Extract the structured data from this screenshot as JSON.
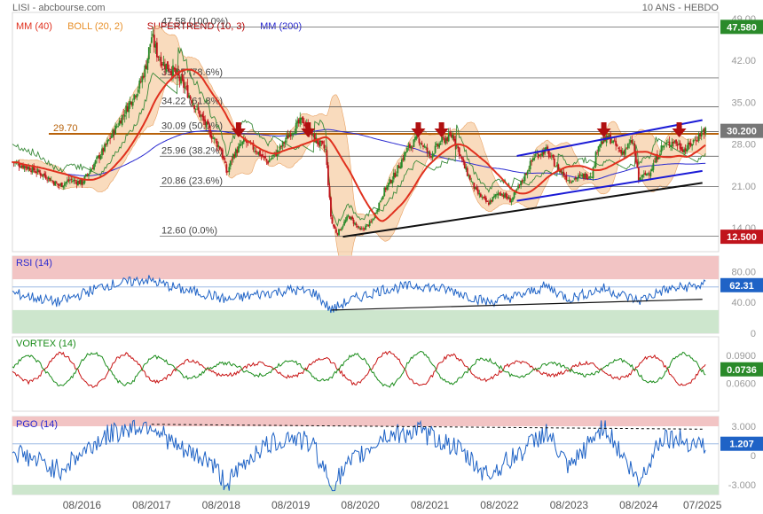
{
  "header": {
    "left": "LISI - abcbourse.com",
    "right": "10 ANS - HEBDO"
  },
  "legend": [
    {
      "label": "MM (40)",
      "color": "#e0301e"
    },
    {
      "label": "BOLL (20, 2)",
      "color": "#e8902a"
    },
    {
      "label": "SUPERTREND (10, 3)",
      "color": "#b80000"
    },
    {
      "label": "MM (200)",
      "color": "#2a2ad0"
    }
  ],
  "colors": {
    "candle_up": "#2a8a2a",
    "candle_down": "#c0141c",
    "boll_fill": "#f6c89a",
    "rsi": "#1f63c6",
    "vortex_plus": "#1a8c1a",
    "vortex_minus": "#c81414",
    "pgo": "#1f63c6",
    "zone_high": "#f2c4c4",
    "zone_low": "#cde6cd",
    "channel": "#1a1ad6",
    "trend_support": "#111111",
    "horizontal_level": "#b8620a",
    "signal_arrow": "#b01010"
  },
  "chart_data": [
    {
      "type": "candlestick",
      "title": "LISI",
      "period": "weekly, 10 years",
      "x_ticks": [
        "08/2016",
        "08/2017",
        "08/2018",
        "08/2019",
        "08/2020",
        "08/2021",
        "08/2022",
        "08/2023",
        "08/2024",
        "07/2025"
      ],
      "y_ticks": [
        14.0,
        21.0,
        28.0,
        35.0,
        42.0,
        49.0
      ],
      "y_range": [
        10,
        50
      ],
      "last_price": "30.200",
      "high_marker": "47.580",
      "low_marker": "12.500",
      "horizontal_level": {
        "label": "29.70",
        "value": 29.7
      },
      "fibonacci": [
        {
          "label": "47.58 (100.0%)",
          "value": 47.58
        },
        {
          "label": "39.05 (78.6%)",
          "value": 39.05
        },
        {
          "label": "34.22 (61.8%)",
          "value": 34.22
        },
        {
          "label": "30.09 (50.0%)",
          "value": 30.09
        },
        {
          "label": "25.96 (38.2%)",
          "value": 25.96
        },
        {
          "label": "20.86 (23.6%)",
          "value": 20.86
        },
        {
          "label": "12.60 (0.0%)",
          "value": 12.6
        }
      ],
      "close_path": [
        [
          "2015-08",
          25.0
        ],
        [
          "2015-11",
          24.0
        ],
        [
          "2016-02",
          22.5
        ],
        [
          "2016-04",
          21.0
        ],
        [
          "2016-06",
          22.0
        ],
        [
          "2016-08",
          21.5
        ],
        [
          "2016-10",
          24.5
        ],
        [
          "2016-12",
          27.5
        ],
        [
          "2017-02",
          31.0
        ],
        [
          "2017-04",
          34.5
        ],
        [
          "2017-06",
          38.0
        ],
        [
          "2017-07",
          41.0
        ],
        [
          "2017-08",
          46.0
        ],
        [
          "2017-09",
          43.0
        ],
        [
          "2017-10",
          41.5
        ],
        [
          "2017-12",
          40.0
        ],
        [
          "2018-02",
          37.0
        ],
        [
          "2018-04",
          33.5
        ],
        [
          "2018-06",
          30.0
        ],
        [
          "2018-08",
          27.0
        ],
        [
          "2018-09",
          23.0
        ],
        [
          "2018-10",
          26.0
        ],
        [
          "2018-12",
          28.5
        ],
        [
          "2019-02",
          27.0
        ],
        [
          "2019-04",
          25.0
        ],
        [
          "2019-06",
          27.0
        ],
        [
          "2019-08",
          30.0
        ],
        [
          "2019-10",
          32.0
        ],
        [
          "2019-12",
          29.0
        ],
        [
          "2020-02",
          27.0
        ],
        [
          "2020-03",
          15.0
        ],
        [
          "2020-04",
          13.0
        ],
        [
          "2020-06",
          16.0
        ],
        [
          "2020-08",
          13.5
        ],
        [
          "2020-10",
          15.0
        ],
        [
          "2020-12",
          20.0
        ],
        [
          "2021-02",
          23.0
        ],
        [
          "2021-04",
          27.0
        ],
        [
          "2021-06",
          29.0
        ],
        [
          "2021-08",
          26.0
        ],
        [
          "2021-10",
          28.5
        ],
        [
          "2021-12",
          29.5
        ],
        [
          "2022-02",
          24.0
        ],
        [
          "2022-04",
          20.0
        ],
        [
          "2022-06",
          18.0
        ],
        [
          "2022-08",
          20.0
        ],
        [
          "2022-10",
          18.5
        ],
        [
          "2022-12",
          22.0
        ],
        [
          "2023-02",
          26.0
        ],
        [
          "2023-04",
          27.0
        ],
        [
          "2023-06",
          24.0
        ],
        [
          "2023-08",
          22.0
        ],
        [
          "2023-10",
          22.5
        ],
        [
          "2023-12",
          23.0
        ],
        [
          "2024-01",
          28.0
        ],
        [
          "2024-03",
          29.0
        ],
        [
          "2024-05",
          26.5
        ],
        [
          "2024-07",
          28.5
        ],
        [
          "2024-08",
          22.0
        ],
        [
          "2024-10",
          23.5
        ],
        [
          "2024-12",
          27.5
        ],
        [
          "2025-02",
          28.5
        ],
        [
          "2025-04",
          27.0
        ],
        [
          "2025-06",
          29.0
        ],
        [
          "2025-07",
          30.2
        ]
      ],
      "signal_arrows": [
        "2018-11",
        "2019-11",
        "2021-06",
        "2021-10",
        "2024-02",
        "2025-03"
      ],
      "support_trend": [
        [
          "2020-05",
          12.5
        ],
        [
          "2025-07",
          21.5
        ]
      ],
      "channel_upper": [
        [
          "2022-11",
          26.0
        ],
        [
          "2025-07",
          32.0
        ]
      ],
      "channel_lower": [
        [
          "2022-11",
          18.5
        ],
        [
          "2025-07",
          23.5
        ]
      ]
    },
    {
      "type": "line",
      "title": "RSI (14)",
      "y_ticks": [
        0,
        40.0,
        80.0
      ],
      "y_range": [
        0,
        100
      ],
      "zones": [
        {
          "from": 70,
          "to": 100,
          "kind": "overbought"
        },
        {
          "from": 0,
          "to": 30,
          "kind": "oversold"
        }
      ],
      "reference_line": 60,
      "last_value": "62.31",
      "path": [
        [
          "2015-08",
          52
        ],
        [
          "2016-04",
          40
        ],
        [
          "2016-12",
          62
        ],
        [
          "2017-04",
          66
        ],
        [
          "2017-07",
          70
        ],
        [
          "2018-01",
          57
        ],
        [
          "2018-06",
          50
        ],
        [
          "2018-09",
          43
        ],
        [
          "2019-02",
          50
        ],
        [
          "2019-08",
          56
        ],
        [
          "2019-12",
          53
        ],
        [
          "2020-03",
          30
        ],
        [
          "2020-06",
          42
        ],
        [
          "2020-12",
          57
        ],
        [
          "2021-06",
          62
        ],
        [
          "2021-12",
          55
        ],
        [
          "2022-06",
          40
        ],
        [
          "2022-12",
          50
        ],
        [
          "2023-04",
          61
        ],
        [
          "2023-08",
          45
        ],
        [
          "2024-02",
          58
        ],
        [
          "2024-08",
          42
        ],
        [
          "2024-12",
          55
        ],
        [
          "2025-04",
          60
        ],
        [
          "2025-07",
          62.31
        ]
      ],
      "trend_line": [
        [
          "2020-03",
          30
        ],
        [
          "2025-07",
          44
        ]
      ]
    },
    {
      "type": "line",
      "title": "VORTEX (14)",
      "y_ticks": [
        "0.0600",
        "0.0900"
      ],
      "last_value": "0.0736",
      "series": [
        {
          "key": "plus",
          "color_key": "vortex_plus"
        },
        {
          "key": "minus",
          "color_key": "vortex_minus"
        }
      ]
    },
    {
      "type": "line",
      "title": "PGO (14)",
      "y_ticks": [
        -3.0,
        0,
        3.0
      ],
      "y_range": [
        -4,
        4
      ],
      "zones": [
        {
          "from": 3,
          "to": 4,
          "kind": "high"
        },
        {
          "from": -4,
          "to": -3,
          "kind": "low"
        }
      ],
      "reference_line": 1.2,
      "last_value": "1.207",
      "path": [
        [
          "2015-08",
          0.5
        ],
        [
          "2016-04",
          -1.5
        ],
        [
          "2016-12",
          2.0
        ],
        [
          "2017-04",
          2.8
        ],
        [
          "2017-08",
          3.2
        ],
        [
          "2018-01",
          0.5
        ],
        [
          "2018-06",
          -0.5
        ],
        [
          "2018-09",
          -3.0
        ],
        [
          "2019-02",
          0.5
        ],
        [
          "2019-08",
          2.0
        ],
        [
          "2019-12",
          1.0
        ],
        [
          "2020-03",
          -3.2
        ],
        [
          "2020-06",
          -1.0
        ],
        [
          "2020-12",
          2.0
        ],
        [
          "2021-06",
          2.5
        ],
        [
          "2021-12",
          1.0
        ],
        [
          "2022-06",
          -2.0
        ],
        [
          "2022-12",
          0.5
        ],
        [
          "2023-04",
          2.5
        ],
        [
          "2023-08",
          -1.5
        ],
        [
          "2024-02",
          3.2
        ],
        [
          "2024-08",
          -2.8
        ],
        [
          "2024-12",
          2.0
        ],
        [
          "2025-04",
          1.5
        ],
        [
          "2025-07",
          1.207
        ]
      ],
      "dashed_resistance": [
        [
          "2017-08",
          3.2
        ],
        [
          "2025-07",
          2.7
        ]
      ]
    }
  ]
}
